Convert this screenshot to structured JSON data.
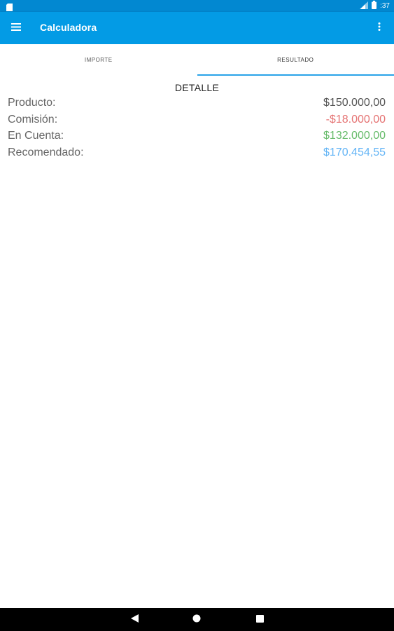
{
  "app": {
    "title": "Calculadora"
  },
  "status_bar": {
    "time": ":37"
  },
  "tabs": [
    {
      "label": "IMPORTE",
      "active": false
    },
    {
      "label": "RESULTADO",
      "active": true
    }
  ],
  "detail": {
    "title": "DETALLE",
    "rows": [
      {
        "label": "Producto:",
        "value": "$150.000,00",
        "color": "#555555"
      },
      {
        "label": "Comisión:",
        "value": "-$18.000,00",
        "color": "#e57373"
      },
      {
        "label": "En Cuenta:",
        "value": "$132.000,00",
        "color": "#66bb6a"
      },
      {
        "label": "Recomendado:",
        "value": "$170.454,55",
        "color": "#64b5f6"
      }
    ]
  },
  "colors": {
    "status_bar": "#0288d1",
    "app_bar": "#039be5",
    "tab_indicator": "#29a3e8"
  },
  "icons": {
    "menu": "hamburger-menu-icon",
    "overflow": "more-vert-icon",
    "back": "back-triangle-icon",
    "home": "home-circle-icon",
    "recents": "recents-square-icon"
  }
}
